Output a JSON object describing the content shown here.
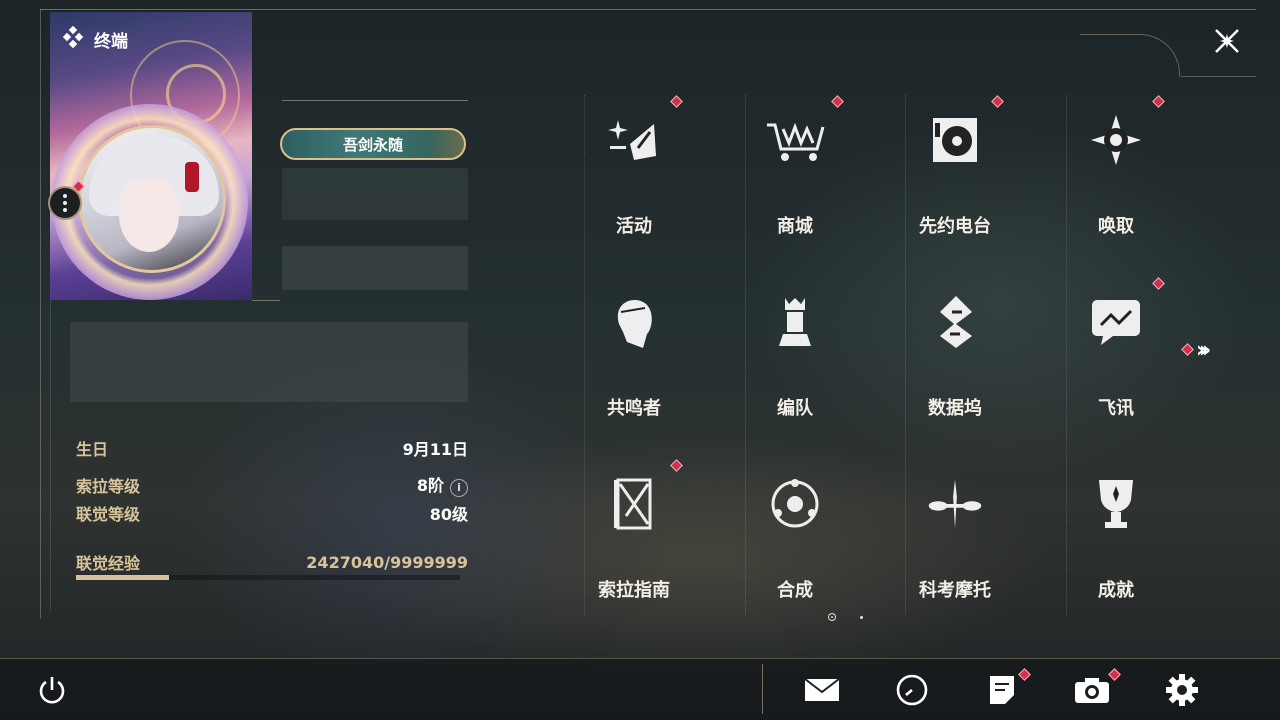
{
  "header": {
    "title": "终端",
    "title_icon": "diamond-cluster-icon",
    "close_icon": "close-star-icon"
  },
  "profile": {
    "title_plate": "吾剑永随",
    "stats": [
      {
        "label": "生日",
        "value": "9月11日"
      },
      {
        "label": "索拉等级",
        "value": "8阶"
      },
      {
        "label": "联觉等级",
        "value": "80级"
      },
      {
        "label": "联觉经验",
        "value": "2427040/9999999"
      }
    ],
    "xp_progress": 0.2427
  },
  "menu": [
    {
      "label": "活动",
      "icon": "sparkle-activity-icon",
      "badge": true
    },
    {
      "label": "商城",
      "icon": "shop-cart-icon",
      "badge": true
    },
    {
      "label": "先约电台",
      "icon": "radio-turntable-icon",
      "badge": true
    },
    {
      "label": "唤取",
      "icon": "compass-summon-icon",
      "badge": true
    },
    {
      "label": "共鸣者",
      "icon": "character-head-icon",
      "badge": false
    },
    {
      "label": "编队",
      "icon": "chess-team-icon",
      "badge": false
    },
    {
      "label": "数据坞",
      "icon": "data-dock-icon",
      "badge": false
    },
    {
      "label": "飞讯",
      "icon": "chat-message-icon",
      "badge": true
    },
    {
      "label": "索拉指南",
      "icon": "guide-book-icon",
      "badge": true
    },
    {
      "label": "合成",
      "icon": "synthesis-icon",
      "badge": false
    },
    {
      "label": "科考摩托",
      "icon": "motorbike-icon",
      "badge": false
    },
    {
      "label": "成就",
      "icon": "trophy-icon",
      "badge": false
    }
  ],
  "pagination": {
    "current": 1,
    "total": 2
  },
  "bottom": [
    "power-icon",
    "mail-icon",
    "clock-icon",
    "notes-icon",
    "camera-icon",
    "settings-gear-icon"
  ],
  "colors": {
    "accent": "#d9c39a",
    "badge": "#d2304a"
  }
}
